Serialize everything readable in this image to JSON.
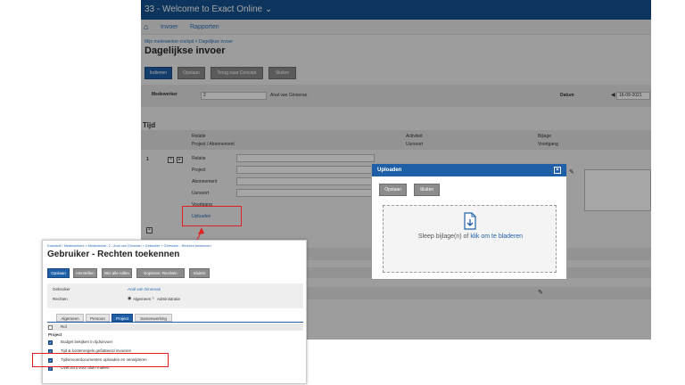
{
  "app": {
    "title": "33 - Welcome to Exact Online",
    "title_caret": "⌄"
  },
  "nav": {
    "items": [
      "Invoer",
      "Rapporten"
    ]
  },
  "page": {
    "breadcrumb": "Mijn medewerker-cockpit > Dagelijkse invoer",
    "title": "Dagelijkse invoer",
    "buttons": {
      "submit": "Indienen",
      "save": "Opslaan",
      "back": "Terug naar Concept",
      "close": "Sluiten"
    },
    "medewerker_label": "Medewerker",
    "medewerker_code": "2",
    "medewerker_name": "Anal van Ginneran",
    "datum_label": "Datum",
    "datum_value": "16-09-2021",
    "section": "Tijd",
    "col_headers": [
      "Relatie",
      "Project / Abonnement",
      "Activiteit",
      "Uursoort",
      "Bijlage",
      "Voortgang"
    ],
    "row_number": "1",
    "row_fields": [
      "Relatie",
      "Project",
      "Abonnement",
      "Uursoort",
      "Voortgang"
    ],
    "upload_link": "Uploaden"
  },
  "dialog": {
    "title": "Uploaden",
    "save": "Opslaan",
    "close": "Sluiten",
    "drop_prefix": "Sleep bijlage(n) of",
    "drop_link": "klik om te bladeren"
  },
  "inset": {
    "breadcrumb": "Exactsoft / Medewerkers » Medewerker: 2 - Anal van Ginneran » Gebruiker » Gebruiker - Rechten toekennen",
    "title": "Gebruiker - Rechten toekennen",
    "buttons": [
      "Opslaan",
      "Herstellen",
      "Wis alle rollen",
      "Kopiëren: Rechten",
      "Sluiten"
    ],
    "gebruiker_label": "Gebruiker",
    "gebruiker_value": "Anal van Ginneran",
    "rechten_label": "Rechten",
    "radio_opts": [
      "Algemeen",
      "Administratie"
    ],
    "tabs": [
      "Algemeen",
      "Persoon",
      "Project",
      "Samenwerking"
    ],
    "rol_header": "Rol",
    "group": "Project",
    "permissions": [
      "Budget bekijken in tijdsinvoer",
      "Tijd & kostenregels gefiatteerd invoeren",
      "Tijdsinvoerdocumenten uploaden en verwijderen",
      "Overzicht voor aluin maken"
    ]
  }
}
